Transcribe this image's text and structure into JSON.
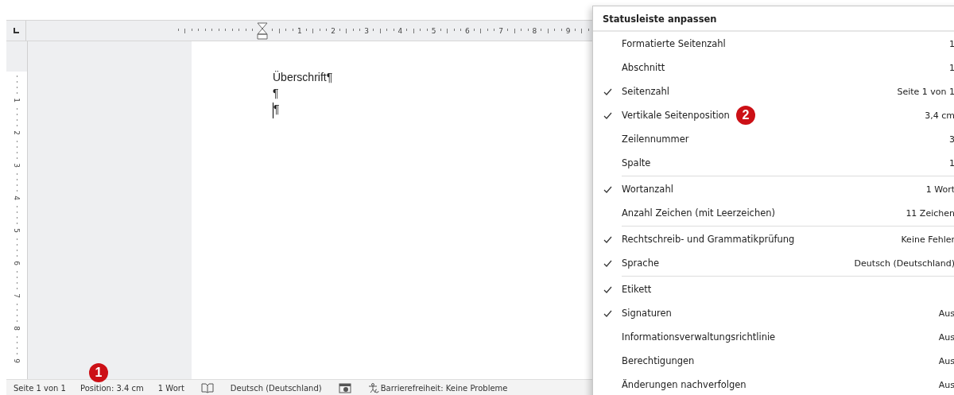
{
  "ruler": {
    "h_labels": [
      "1",
      "2",
      "3",
      "4",
      "5",
      "6",
      "7",
      "8",
      "9"
    ],
    "v_labels": [
      "1",
      "2",
      "3",
      "4",
      "5",
      "6",
      "7",
      "8",
      "9"
    ]
  },
  "document": {
    "lines": [
      {
        "kind": "heading",
        "text": "Überschrift¶"
      },
      {
        "kind": "mark",
        "text": "¶"
      },
      {
        "kind": "cursor",
        "text": "¶"
      }
    ]
  },
  "status_bar": [
    {
      "kind": "text",
      "text": "Seite 1 von 1"
    },
    {
      "kind": "text",
      "text": "Position: 3.4 cm"
    },
    {
      "kind": "text",
      "text": "1 Wort"
    },
    {
      "kind": "book"
    },
    {
      "kind": "text",
      "text": "Deutsch (Deutschland)"
    },
    {
      "kind": "camera"
    },
    {
      "kind": "access",
      "text": "Barrierefreiheit: Keine Probleme"
    }
  ],
  "callouts": [
    {
      "text": "1",
      "kind": "status"
    },
    {
      "text": "2",
      "kind": "menu"
    }
  ],
  "menu": {
    "title": "Statusleiste anpassen",
    "items": [
      {
        "kind": "option",
        "checked": false,
        "label": "Formatierte Seitenzahl",
        "value": "1"
      },
      {
        "kind": "option",
        "checked": false,
        "label": "Abschnitt",
        "value": "1"
      },
      {
        "kind": "option",
        "checked": true,
        "label": "Seitenzahl",
        "value": "Seite 1 von 1"
      },
      {
        "kind": "option",
        "checked": true,
        "label": "Vertikale Seitenposition",
        "value": "3,4 cm"
      },
      {
        "kind": "option",
        "checked": false,
        "label": "Zeilennummer",
        "value": "3"
      },
      {
        "kind": "option",
        "checked": false,
        "label": "Spalte",
        "value": "1"
      },
      {
        "kind": "separator"
      },
      {
        "kind": "option",
        "checked": true,
        "label": "Wortanzahl",
        "value": "1 Wort"
      },
      {
        "kind": "option",
        "checked": false,
        "label": "Anzahl Zeichen (mit Leerzeichen)",
        "value": "11 Zeichen"
      },
      {
        "kind": "separator"
      },
      {
        "kind": "option",
        "checked": true,
        "label": "Rechtschreib- und Grammatikprüfung",
        "value": "Keine Fehler"
      },
      {
        "kind": "option",
        "checked": true,
        "label": "Sprache",
        "value": "Deutsch (Deutschland)"
      },
      {
        "kind": "separator"
      },
      {
        "kind": "option",
        "checked": true,
        "label": "Etikett"
      },
      {
        "kind": "option",
        "checked": true,
        "label": "Signaturen",
        "value": "Aus"
      },
      {
        "kind": "option",
        "checked": false,
        "label": "Informationsverwaltungsrichtlinie",
        "value": "Aus"
      },
      {
        "kind": "option",
        "checked": false,
        "label": "Berechtigungen",
        "value": "Aus"
      },
      {
        "kind": "option",
        "checked": false,
        "label": "Änderungen nachverfolgen",
        "value": "Aus"
      }
    ]
  }
}
